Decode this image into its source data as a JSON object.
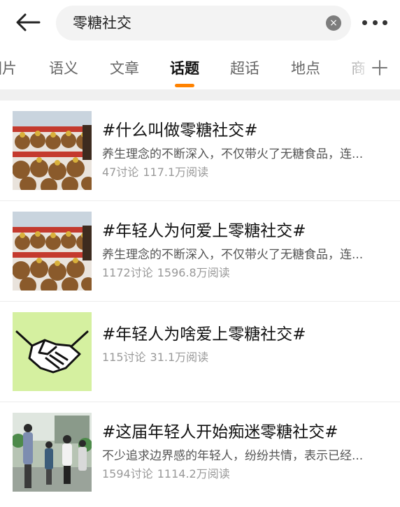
{
  "search": {
    "query": "零糖社交",
    "clear_glyph": "×"
  },
  "tabs": [
    {
      "label": "图片"
    },
    {
      "label": "语义"
    },
    {
      "label": "文章"
    },
    {
      "label": "话题",
      "active": true
    },
    {
      "label": "超话"
    },
    {
      "label": "地点"
    },
    {
      "label": "商"
    }
  ],
  "icons": {
    "back": "back-arrow-icon",
    "more": "more-dots-icon",
    "clear": "clear-icon",
    "add": "plus-icon"
  },
  "colors": {
    "accent": "#ff8200",
    "search_bg": "#f3f3f3",
    "band": "#f0f0f0"
  },
  "topics": [
    {
      "title": "#什么叫做零糖社交#",
      "desc": "养生理念的不断深入，不仅带火了无糖食品，连...",
      "discussions": "47讨论",
      "reads": "117.1万阅读",
      "thumb": "capybara-plush-thumbnail"
    },
    {
      "title": "#年轻人为何爱上零糖社交#",
      "desc": "养生理念的不断深入，不仅带火了无糖食品，连...",
      "discussions": "1172讨论",
      "reads": "1596.8万阅读",
      "thumb": "capybara-plush-thumbnail"
    },
    {
      "title": "#年轻人为啥爱上零糖社交#",
      "desc": "",
      "discussions": "115讨论",
      "reads": "31.1万阅读",
      "thumb": "handshake-thumbnail"
    },
    {
      "title": "#这届年轻人开始痴迷零糖社交#",
      "desc": "不少追求边界感的年轻人，纷纷共情，表示已经...",
      "discussions": "1594讨论",
      "reads": "1114.2万阅读",
      "thumb": "people-walking-thumbnail"
    }
  ]
}
